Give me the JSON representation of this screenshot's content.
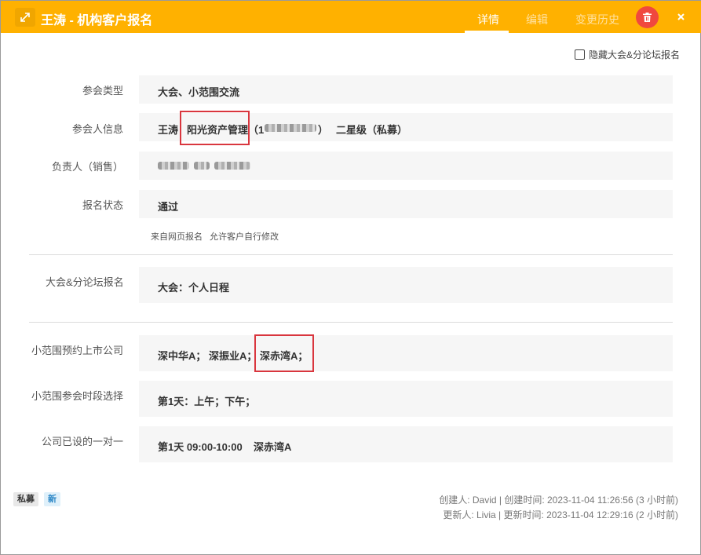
{
  "window": {
    "title": "王涛 - 机构客户报名",
    "tabs": [
      {
        "label": "详情",
        "active": true
      },
      {
        "label": "编辑",
        "active": false
      },
      {
        "label": "变更历史",
        "active": false
      }
    ],
    "header_color": "#ffb100",
    "delete_color": "#f0483e"
  },
  "options": {
    "hide_forum_label": "隐藏大会&分论坛报名",
    "hide_forum_checked": false
  },
  "fields": {
    "meeting_type": {
      "label": "参会类型",
      "value": "大会、小范围交流"
    },
    "attendee": {
      "label": "参会人信息",
      "name": "王涛",
      "separator": "|",
      "company": "阳光资产管理",
      "phone_open": "（1",
      "phone_close": "）",
      "level": "二星级（私募）"
    },
    "owner": {
      "label": "负责人（销售）"
    },
    "status": {
      "label": "报名状态",
      "value": "通过"
    },
    "status_notes": [
      "来自网页报名",
      "允许客户自行修改"
    ],
    "forum": {
      "label": "大会&分论坛报名",
      "value": "大会：个人日程"
    },
    "small_companies": {
      "label": "小范围预约上市公司",
      "items": [
        "深中华A；",
        "深振业A；",
        "深赤湾A；"
      ]
    },
    "small_slots": {
      "label": "小范围参会时段选择",
      "value": "第1天：上午；下午；"
    },
    "one_on_one": {
      "label": "公司已设的一对一",
      "day_time": "第1天 09:00-10:00",
      "company": "深赤湾A"
    }
  },
  "tags": [
    "私募",
    "新"
  ],
  "footer": {
    "created": "创建人: David | 创建时间: 2023-11-04 11:26:56 (3 小时前)",
    "updated": "更新人: Livia | 更新时间: 2023-11-04 12:29:16 (2 小时前)"
  }
}
